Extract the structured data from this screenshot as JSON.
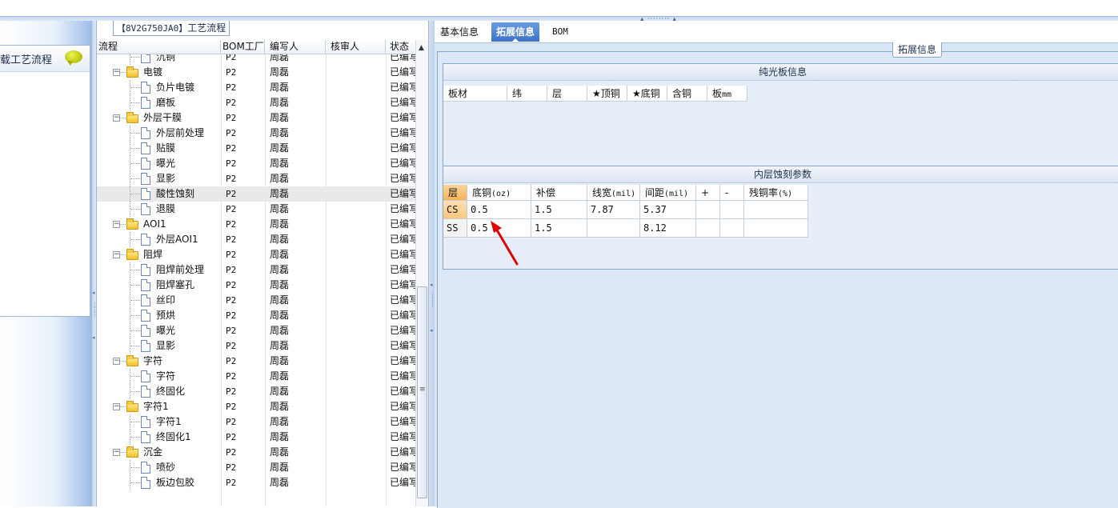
{
  "left": {
    "title": "载工艺流程",
    "chat_icon": "speech-bubble-icon"
  },
  "mid": {
    "title_code": "【8V2G750JA0】",
    "title_text": "工艺流程",
    "headers": [
      "流程",
      "BOM工厂",
      "编写人",
      "核审人",
      "状态"
    ],
    "rows": [
      {
        "level": 2,
        "type": "doc",
        "name": "沉铜",
        "bom": "P2",
        "writer": "周磊",
        "state": "已编写"
      },
      {
        "level": 1,
        "type": "folder",
        "name": "电镀",
        "bom": "P2",
        "writer": "周磊",
        "state": "已编写"
      },
      {
        "level": 2,
        "type": "doc",
        "name": "负片电镀",
        "bom": "P2",
        "writer": "周磊",
        "state": "已编写"
      },
      {
        "level": 2,
        "type": "doc",
        "name": "磨板",
        "bom": "P2",
        "writer": "周磊",
        "state": "已编写"
      },
      {
        "level": 1,
        "type": "folder",
        "name": "外层干膜",
        "bom": "P2",
        "writer": "周磊",
        "state": "已编写"
      },
      {
        "level": 2,
        "type": "doc",
        "name": "外层前处理",
        "bom": "P2",
        "writer": "周磊",
        "state": "已编写"
      },
      {
        "level": 2,
        "type": "doc",
        "name": "贴膜",
        "bom": "P2",
        "writer": "周磊",
        "state": "已编写"
      },
      {
        "level": 2,
        "type": "doc",
        "name": "曝光",
        "bom": "P2",
        "writer": "周磊",
        "state": "已编写"
      },
      {
        "level": 2,
        "type": "doc",
        "name": "显影",
        "bom": "P2",
        "writer": "周磊",
        "state": "已编写"
      },
      {
        "level": 2,
        "type": "doc",
        "name": "酸性蚀刻",
        "bom": "P2",
        "writer": "周磊",
        "state": "已编写",
        "selected": true
      },
      {
        "level": 2,
        "type": "doc",
        "name": "退膜",
        "bom": "P2",
        "writer": "周磊",
        "state": "已编写"
      },
      {
        "level": 1,
        "type": "folder",
        "name": "AOI1",
        "bom": "P2",
        "writer": "周磊",
        "state": "已编写"
      },
      {
        "level": 2,
        "type": "doc",
        "name": "外层AOI1",
        "bom": "P2",
        "writer": "周磊",
        "state": "已编写"
      },
      {
        "level": 1,
        "type": "folder",
        "name": "阻焊",
        "bom": "P2",
        "writer": "周磊",
        "state": "已编写"
      },
      {
        "level": 2,
        "type": "doc",
        "name": "阻焊前处理",
        "bom": "P2",
        "writer": "周磊",
        "state": "已编写"
      },
      {
        "level": 2,
        "type": "doc",
        "name": "阻焊塞孔",
        "bom": "P2",
        "writer": "周磊",
        "state": "已编写"
      },
      {
        "level": 2,
        "type": "doc",
        "name": "丝印",
        "bom": "P2",
        "writer": "周磊",
        "state": "已编写"
      },
      {
        "level": 2,
        "type": "doc",
        "name": "预烘",
        "bom": "P2",
        "writer": "周磊",
        "state": "已编写"
      },
      {
        "level": 2,
        "type": "doc",
        "name": "曝光",
        "bom": "P2",
        "writer": "周磊",
        "state": "已编写"
      },
      {
        "level": 2,
        "type": "doc",
        "name": "显影",
        "bom": "P2",
        "writer": "周磊",
        "state": "已编写"
      },
      {
        "level": 1,
        "type": "folder",
        "name": "字符",
        "bom": "P2",
        "writer": "周磊",
        "state": "已编写"
      },
      {
        "level": 2,
        "type": "doc",
        "name": "字符",
        "bom": "P2",
        "writer": "周磊",
        "state": "已编写"
      },
      {
        "level": 2,
        "type": "doc",
        "name": "终固化",
        "bom": "P2",
        "writer": "周磊",
        "state": "已编写"
      },
      {
        "level": 1,
        "type": "folder",
        "name": "字符1",
        "bom": "P2",
        "writer": "周磊",
        "state": "已编写"
      },
      {
        "level": 2,
        "type": "doc",
        "name": "字符1",
        "bom": "P2",
        "writer": "周磊",
        "state": "已编写"
      },
      {
        "level": 2,
        "type": "doc",
        "name": "终固化1",
        "bom": "P2",
        "writer": "周磊",
        "state": "已编写"
      },
      {
        "level": 1,
        "type": "folder",
        "name": "沉金",
        "bom": "P2",
        "writer": "周磊",
        "state": "已编写"
      },
      {
        "level": 2,
        "type": "doc",
        "name": "喷砂",
        "bom": "P2",
        "writer": "周磊",
        "state": "已编写"
      },
      {
        "level": 2,
        "type": "doc",
        "name": "板边包胶",
        "bom": "P2",
        "writer": "周磊",
        "state": "已编写"
      }
    ]
  },
  "right": {
    "tabs": [
      "基本信息",
      "拓展信息",
      "BOM"
    ],
    "active_tab": 1,
    "group_title": "拓展信息",
    "bare_board": {
      "title": "纯光板信息",
      "headers": [
        "板材",
        "纬",
        "层",
        "★顶铜",
        "★底铜",
        "含铜",
        "板"
      ],
      "last_header_unit": "mm"
    },
    "etch": {
      "title": "内层蚀刻参数",
      "headers": [
        {
          "label": "层",
          "unit": ""
        },
        {
          "label": "底铜",
          "unit": "(oz)"
        },
        {
          "label": "补偿",
          "unit": ""
        },
        {
          "label": "线宽",
          "unit": "(mil)"
        },
        {
          "label": "间距",
          "unit": "(mil)"
        },
        {
          "label": "+",
          "unit": ""
        },
        {
          "label": "-",
          "unit": ""
        },
        {
          "label": "残铜率",
          "unit": "(%)"
        }
      ],
      "rows": [
        [
          "CS",
          "0.5",
          "1.5",
          "7.87",
          "5.37",
          "",
          "",
          ""
        ],
        [
          "SS",
          "0.5",
          "1.5",
          "",
          "8.12",
          "",
          "",
          ""
        ]
      ]
    }
  },
  "colors": {
    "accent_tab": "#3b74c6",
    "selected_header": "#f6b35a",
    "arrow": "#e00000"
  }
}
